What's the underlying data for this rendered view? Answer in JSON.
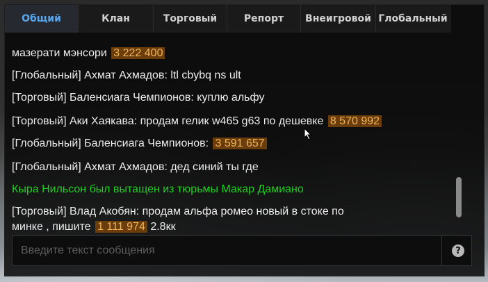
{
  "tabs": [
    "Общий",
    "Клан",
    "Торговый",
    "Репорт",
    "Внеигровой",
    "Глобальный"
  ],
  "active_tab": "Общий",
  "messages": [
    {
      "text": "мазерати мэнсори",
      "price": "3 222 400"
    },
    {
      "text": "[Глобальный] Ахмат Ахмадов: ltl cbybq ns ult"
    },
    {
      "text": "[Торговый] Баленсиага Чемпионов: куплю альфу"
    },
    {
      "text": "[Торговый] Аки Хаякава: продам гелик w465 g63 по дешевке",
      "price": "8 570 992"
    },
    {
      "text": "[Глобальный] Баленсиага Чемпионов:",
      "price": "3 591 657"
    },
    {
      "text": "[Глобальный] Ахмат Ахмадов: дед синий ты где"
    },
    {
      "text": "Кыра Нильсон был вытащен из тюрьмы Макар Дамиано"
    },
    {
      "text": "[Торговый] Влад Акобян: продам альфа ромео новый в стоке по"
    },
    {
      "text": "минке , пишите",
      "price": "1 111 974",
      "suffix": "2.8кк"
    }
  ],
  "input": {
    "placeholder": "Введите текст сообщения",
    "value": ""
  },
  "help_label": "?",
  "colors": {
    "active_tab": "#5aa7ee",
    "price_bg": "#6b3d0a",
    "price_text": "#f0b45a",
    "system_message": "#1ed01e"
  }
}
